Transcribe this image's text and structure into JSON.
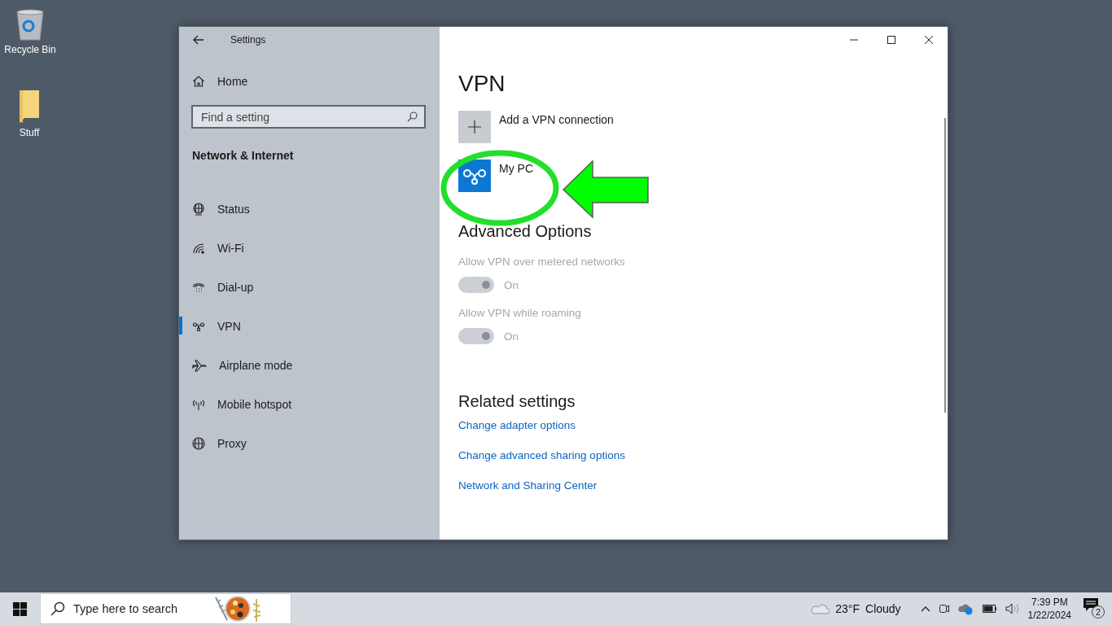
{
  "desktop_icons": [
    {
      "label": "Recycle Bin",
      "kind": "bin"
    },
    {
      "label": "Stuff",
      "kind": "folder"
    }
  ],
  "window": {
    "title": "Settings",
    "sidebar": {
      "home": "Home",
      "search": {
        "placeholder": "Find a setting"
      },
      "section": "Network & Internet",
      "items": [
        {
          "label": "Status",
          "kind": "status",
          "selected": false
        },
        {
          "label": "Wi-Fi",
          "kind": "wifi",
          "selected": false
        },
        {
          "label": "Dial-up",
          "kind": "dialup",
          "selected": false
        },
        {
          "label": "VPN",
          "kind": "vpn",
          "selected": true
        },
        {
          "label": "Airplane mode",
          "kind": "airplane",
          "selected": false
        },
        {
          "label": "Mobile hotspot",
          "kind": "hotspot",
          "selected": false
        },
        {
          "label": "Proxy",
          "kind": "proxy",
          "selected": false
        }
      ]
    },
    "heading": "VPN",
    "connections": [
      {
        "label": "Add a VPN connection",
        "kind": "add"
      },
      {
        "label": "My PC",
        "kind": "vpn"
      }
    ],
    "advanced": {
      "heading": "Advanced Options",
      "options": [
        {
          "label": "Allow VPN over metered networks",
          "on": true,
          "disabled": true,
          "state": "On"
        },
        {
          "label": "Allow VPN while roaming",
          "on": true,
          "disabled": true,
          "state": "On"
        }
      ]
    },
    "related": {
      "heading": "Related settings",
      "links": [
        "Change adapter options",
        "Change advanced sharing options",
        "Network and Sharing Center"
      ]
    }
  },
  "taskbar": {
    "search": {
      "placeholder": "Type here to search"
    },
    "temperature": "23°F",
    "weather": "Cloudy",
    "time": "7:39 PM",
    "date": "1/22/2024",
    "notifications": "2"
  }
}
